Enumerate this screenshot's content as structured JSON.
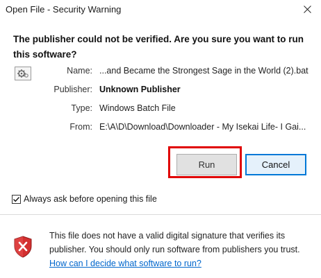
{
  "window": {
    "title": "Open File - Security Warning",
    "close_glyph": "✕"
  },
  "headline": "The publisher could not be verified.  Are you sure you want to run this software?",
  "file_info": {
    "icon": "batch-file-gear-icon",
    "rows": [
      {
        "label": "Name:",
        "value": "...and Became the Strongest Sage in the World (2).bat",
        "bold": false
      },
      {
        "label": "Publisher:",
        "value": "Unknown Publisher",
        "bold": true
      },
      {
        "label": "Type:",
        "value": "Windows Batch File",
        "bold": false
      },
      {
        "label": "From:",
        "value": "E:\\A\\D\\Download\\Downloader - My Isekai Life- I Gai...",
        "bold": false
      }
    ]
  },
  "buttons": {
    "run_label": "Run",
    "cancel_label": "Cancel"
  },
  "always_ask": {
    "label": "Always ask before opening this file",
    "checked": true
  },
  "warning": {
    "text": "This file does not have a valid digital signature that verifies its publisher.  You should only run software from publishers you trust.",
    "link_text": "How can I decide what software to run?",
    "icon": "shield-error-icon"
  },
  "colors": {
    "highlight": "#e00000",
    "accent": "#0078d7",
    "link": "#0066cc",
    "shield_red": "#d32f2f"
  }
}
